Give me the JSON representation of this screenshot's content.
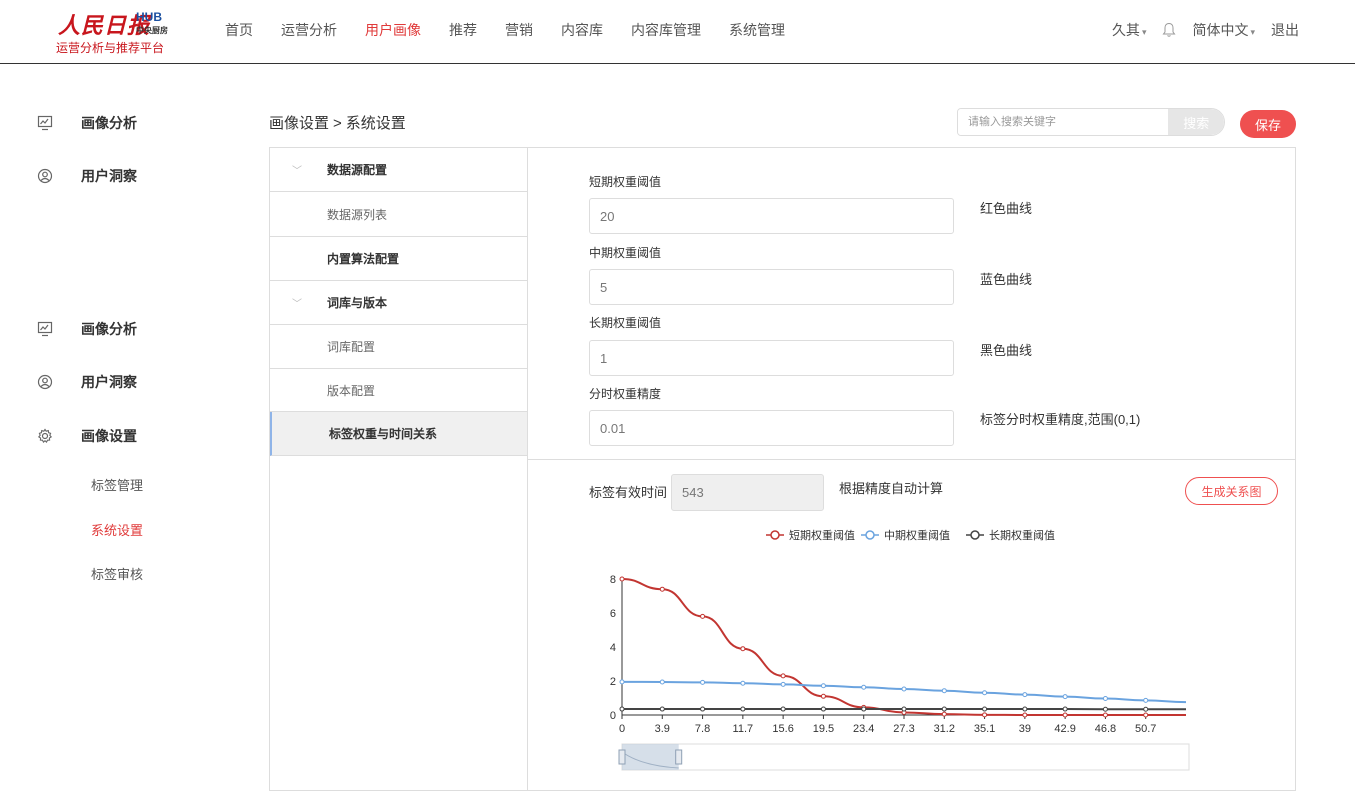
{
  "logo": {
    "brand": "人民日报",
    "hub": "HUB",
    "hub_sub": "中央厨房",
    "tagline": "运营分析与推荐平台"
  },
  "nav": {
    "items": [
      {
        "label": "首页"
      },
      {
        "label": "运营分析"
      },
      {
        "label": "用户画像",
        "active": true
      },
      {
        "label": "推荐"
      },
      {
        "label": "营销"
      },
      {
        "label": "内容库"
      },
      {
        "label": "内容库管理"
      },
      {
        "label": "系统管理"
      }
    ]
  },
  "header_right": {
    "user": "久其",
    "language": "简体中文",
    "logout": "退出"
  },
  "sidebar": {
    "group1": [
      {
        "label": "画像分析",
        "icon": "analysis-icon"
      },
      {
        "label": "用户洞察",
        "icon": "user-insight-icon"
      }
    ],
    "group2": [
      {
        "label": "画像分析",
        "icon": "analysis-icon"
      },
      {
        "label": "用户洞察",
        "icon": "user-insight-icon"
      },
      {
        "label": "画像设置",
        "icon": "gear-icon"
      }
    ],
    "sub_items": [
      {
        "label": "标签管理"
      },
      {
        "label": "系统设置",
        "active": true
      },
      {
        "label": "标签审核"
      }
    ]
  },
  "breadcrumb": {
    "parent": "画像设置",
    "separator": ">",
    "current": "系统设置"
  },
  "search": {
    "placeholder": "请输入搜索关键字",
    "button": "搜索"
  },
  "save_label": "保存",
  "tree": {
    "items": [
      {
        "label": "数据源配置",
        "type": "group",
        "expanded": true
      },
      {
        "label": "数据源列表",
        "type": "child"
      },
      {
        "label": "内置算法配置",
        "type": "group"
      },
      {
        "label": "词库与版本",
        "type": "group",
        "expanded": true
      },
      {
        "label": "词库配置",
        "type": "child"
      },
      {
        "label": "版本配置",
        "type": "child"
      },
      {
        "label": "标签权重与时间关系",
        "type": "group",
        "selected": true
      }
    ]
  },
  "form": {
    "fields": [
      {
        "label": "短期权重阈值",
        "value": "20",
        "note": "红色曲线"
      },
      {
        "label": "中期权重阈值",
        "value": "5",
        "note": "蓝色曲线"
      },
      {
        "label": "长期权重阈值",
        "value": "1",
        "note": "黑色曲线"
      },
      {
        "label": "分时权重精度",
        "value": "0.01",
        "note": "标签分时权重精度,范围(0,1)"
      }
    ]
  },
  "effective": {
    "label": "标签有效时间",
    "value": "543",
    "note": "根据精度自动计算",
    "generate_button": "生成关系图"
  },
  "chart_data": {
    "type": "line",
    "x": [
      0,
      3.9,
      7.8,
      11.7,
      15.6,
      19.5,
      23.4,
      27.3,
      31.2,
      35.1,
      39,
      42.9,
      46.8,
      50.7,
      54.6
    ],
    "x_tick_labels": [
      "0",
      "3.9",
      "7.8",
      "11.7",
      "15.6",
      "19.5",
      "23.4",
      "27.3",
      "31.2",
      "35.1",
      "39",
      "42.9",
      "46.8",
      "50.7"
    ],
    "y_ticks": [
      0,
      2,
      4,
      6,
      8
    ],
    "ylim": [
      0,
      8
    ],
    "legend_position": "top-center",
    "dataZoom": {
      "start_fraction": 0,
      "end_fraction": 0.1
    },
    "series": [
      {
        "name": "短期权重阈值",
        "color": "#c23531",
        "values": [
          8.0,
          7.4,
          5.8,
          3.9,
          2.3,
          1.1,
          0.45,
          0.15,
          0.05,
          0.01,
          0.0,
          0.0,
          0.0,
          0.0,
          0.0
        ]
      },
      {
        "name": "中期权重阈值",
        "color": "#6aa3df",
        "values": [
          1.95,
          1.94,
          1.92,
          1.87,
          1.8,
          1.72,
          1.63,
          1.53,
          1.43,
          1.31,
          1.2,
          1.08,
          0.97,
          0.86,
          0.76
        ]
      },
      {
        "name": "长期权重阈值",
        "color": "#444444",
        "values": [
          0.35,
          0.35,
          0.35,
          0.35,
          0.35,
          0.35,
          0.35,
          0.35,
          0.35,
          0.35,
          0.35,
          0.35,
          0.34,
          0.34,
          0.34
        ]
      }
    ]
  }
}
